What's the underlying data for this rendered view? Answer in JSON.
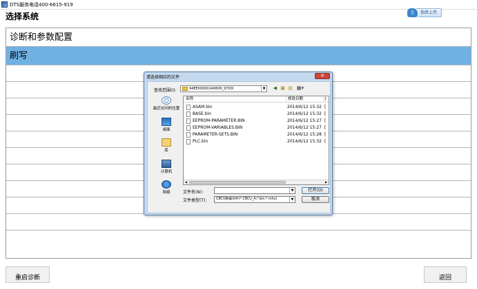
{
  "window": {
    "title": "DTS服务电话400-6615-919"
  },
  "section_title": "选择系统",
  "upload_button": "指挥上传",
  "list_items": [
    {
      "label": "诊断和参数配置",
      "selected": false
    },
    {
      "label": "刷写",
      "selected": true
    }
  ],
  "bottom": {
    "restart_label": "重启诊断",
    "back_label": "返回"
  },
  "dialog": {
    "title": "请选择相应的文件",
    "close_symbol": "✕",
    "look_in_label": "查找范围(I):",
    "look_in_value": "94EE00000140606_ST00I",
    "places": [
      {
        "label": "最近访问的位置",
        "icon": "recent-places-icon"
      },
      {
        "label": "桌面",
        "icon": "desktop-icon"
      },
      {
        "label": "库",
        "icon": "library-icon"
      },
      {
        "label": "计算机",
        "icon": "computer-icon"
      },
      {
        "label": "网络",
        "icon": "network-icon"
      }
    ],
    "columns": {
      "name": "名称",
      "date": "修改日期",
      "extra": "["
    },
    "files": [
      {
        "name": "ASAM.bin",
        "date": "2014/6/12 15:32",
        "extra": "["
      },
      {
        "name": "BASE.bin",
        "date": "2014/6/12 15:32",
        "extra": "["
      },
      {
        "name": "EEPROM-PARAMETER.BIN",
        "date": "2014/6/12 15:27",
        "extra": "["
      },
      {
        "name": "EEPROM-VARIABLES.BIN",
        "date": "2014/6/12 15:27",
        "extra": "["
      },
      {
        "name": "PARAMETER-SETS.BIN",
        "date": "2014/6/12 15:28",
        "extra": "["
      },
      {
        "name": "PLC.bin",
        "date": "2014/6/12 15:32",
        "extra": "["
      }
    ],
    "filename_label": "文件名(N):",
    "filename_value": "",
    "filetype_label": "文件类型(T):",
    "filetype_value": "CBCU数据文件(*.CBCU_A;*.bin;*.mhx)",
    "open_label": "打开(O)",
    "cancel_label": "取消"
  }
}
